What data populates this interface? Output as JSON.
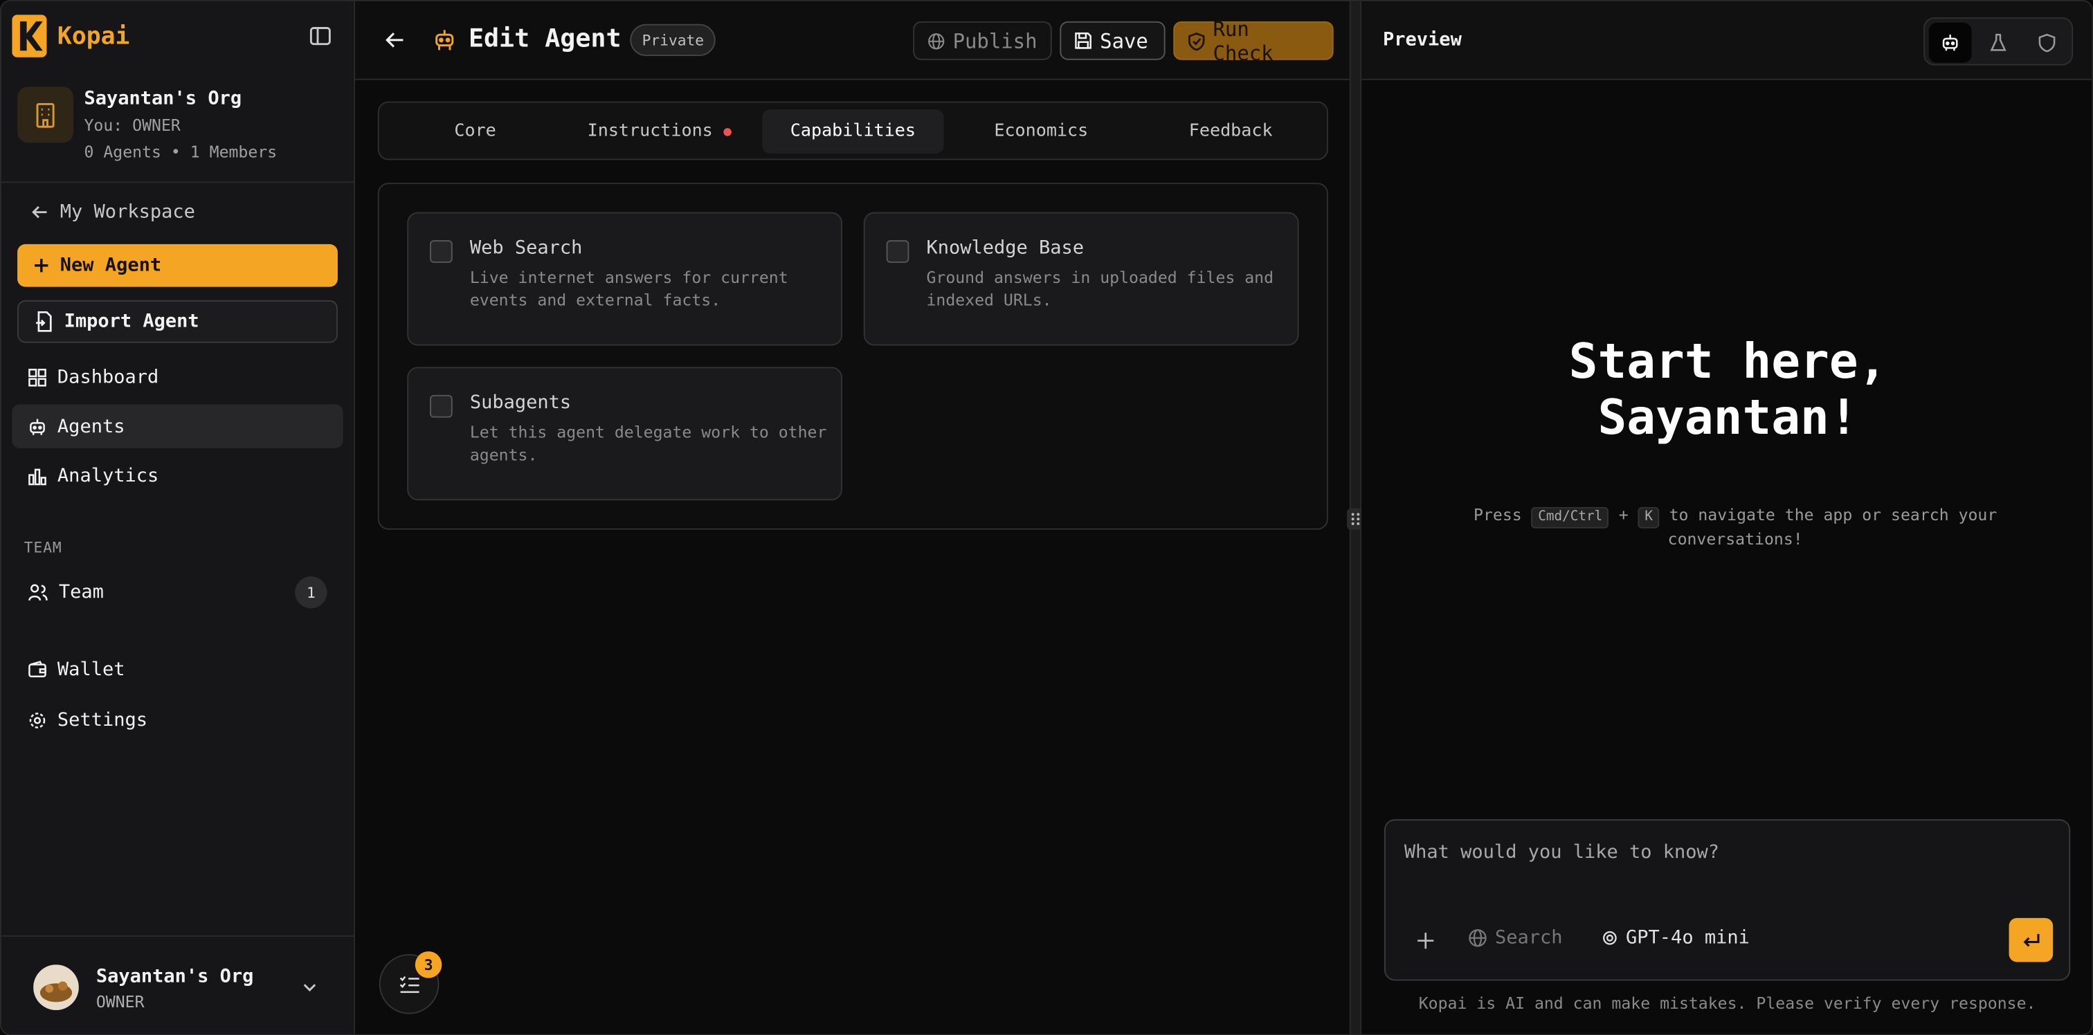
{
  "app": {
    "name": "Kopai"
  },
  "org": {
    "name": "Sayantan's Org",
    "role": "You: OWNER",
    "stats": "0 Agents • 1 Members"
  },
  "sidebar": {
    "back_label": "My Workspace",
    "new_agent": "New Agent",
    "import_agent": "Import Agent",
    "items": [
      {
        "label": "Dashboard",
        "icon": "grid-icon"
      },
      {
        "label": "Agents",
        "icon": "robot-icon"
      },
      {
        "label": "Analytics",
        "icon": "bar-chart-icon"
      }
    ],
    "team_section": "TEAM",
    "team_item": {
      "label": "Team",
      "count": "1",
      "icon": "users-icon"
    },
    "wallet": "Wallet",
    "settings": "Settings",
    "footer": {
      "name": "Sayantan's Org",
      "role": "OWNER"
    }
  },
  "editor": {
    "title": "Edit Agent",
    "visibility": "Private",
    "publish": "Publish",
    "save": "Save",
    "run_check": "Run Check",
    "tabs": [
      "Core",
      "Instructions",
      "Capabilities",
      "Economics",
      "Feedback"
    ],
    "active_tab": "Capabilities",
    "capabilities": [
      {
        "title": "Web Search",
        "desc": "Live internet answers for current events and external facts.",
        "checked": false
      },
      {
        "title": "Knowledge Base",
        "desc": "Ground answers in uploaded files and indexed URLs.",
        "checked": false
      },
      {
        "title": "Subagents",
        "desc": "Let this agent delegate work to other agents.",
        "checked": false
      }
    ],
    "tasks_badge": "3"
  },
  "preview": {
    "title": "Preview",
    "hero_line1": "Start here,",
    "hero_line2": "Sayantan!",
    "hint_press": "Press",
    "hint_key1": "Cmd/Ctrl",
    "hint_plus": "+",
    "hint_key2": "K",
    "hint_rest": "to navigate the app or search your conversations!",
    "placeholder": "What would you like to know?",
    "search": "Search",
    "model": "GPT-4o mini",
    "disclaimer": "Kopai is AI and can make mistakes. Please verify every response."
  },
  "colors": {
    "accent": "#f5a524",
    "background": "#0a0a0a",
    "sidebar": "#161618"
  }
}
